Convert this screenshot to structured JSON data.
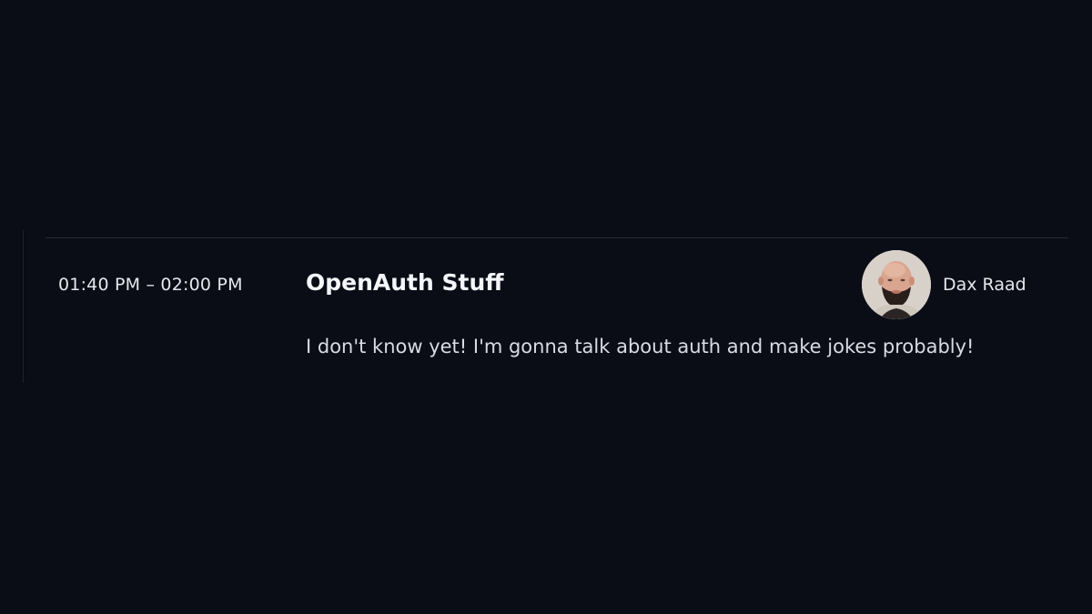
{
  "session": {
    "time": "01:40 PM – 02:00 PM",
    "title": "OpenAuth Stuff",
    "description": "I don't know yet! I'm gonna talk about auth and make jokes probably!",
    "speaker": {
      "name": "Dax Raad",
      "avatar_icon": "speaker-portrait"
    }
  },
  "colors": {
    "background": "#0a0c16",
    "divider": "#262a38",
    "text_primary": "#f5f6fa",
    "text_secondary": "#d9dbe4"
  }
}
